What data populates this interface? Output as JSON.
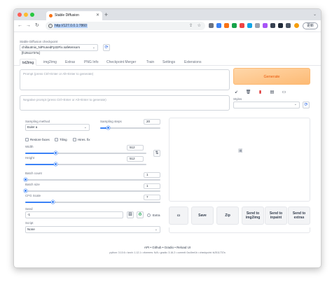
{
  "browser": {
    "tab_title": "Stable Diffusion",
    "url": "http://127.0.0.1:7860",
    "profile_label": "更新",
    "traffic_colors": [
      "#ff5f57",
      "#febc2e",
      "#28c840"
    ]
  },
  "checkpoint": {
    "label": "Stable Diffusion checkpoint",
    "value": "chilloutmix_NiPrunedFp32Fix.safetensors [fc2511737a]"
  },
  "tabs": [
    "txt2img",
    "img2img",
    "Extras",
    "PNG Info",
    "Checkpoint Merger",
    "Train",
    "Settings",
    "Extensions"
  ],
  "prompt": {
    "placeholder": "Prompt (press Ctrl+Enter or Alt+Enter to generate)",
    "negative_placeholder": "Negative prompt (press Ctrl+Enter or Alt+Enter to generate)"
  },
  "generate_label": "Generate",
  "styles_label": "Styles",
  "params": {
    "sampling_method_label": "Sampling method",
    "sampling_method": "Euler a",
    "sampling_steps_label": "Sampling steps",
    "sampling_steps": "20",
    "sampling_steps_fraction": 0.13,
    "restore_faces": "Restore faces",
    "tiling": "Tiling",
    "hires_fix": "Hires. fix",
    "width_label": "Width",
    "width": "512",
    "width_fraction": 0.25,
    "height_label": "Height",
    "height": "512",
    "height_fraction": 0.25,
    "batch_count_label": "Batch count",
    "batch_count": "1",
    "batch_size_label": "Batch size",
    "batch_size": "1",
    "cfg_label": "CFG Scale",
    "cfg": "7",
    "cfg_fraction": 0.2,
    "seed_label": "Seed",
    "seed": "-1",
    "extra_label": "Extra",
    "script_label": "Script",
    "script": "None"
  },
  "actions": {
    "save": "Save",
    "zip": "Zip",
    "send_img2img": "Send to img2img",
    "send_inpaint": "Send to inpaint",
    "send_extras": "Send to extras"
  },
  "footer": {
    "links": "API  •  Github  •  Gradio  •  Reload UI",
    "info": "python: 3.10.6  •  torch: 1.12.1  •  xformers: N/A  •  gradio: 3.16.2  •  commit: 0cc0ee1b  •  checkpoint: fc2511737a"
  },
  "colors": {
    "accent": "#3b82f6",
    "generate_text": "#ea580c",
    "generate_bg": "#fdba74"
  }
}
